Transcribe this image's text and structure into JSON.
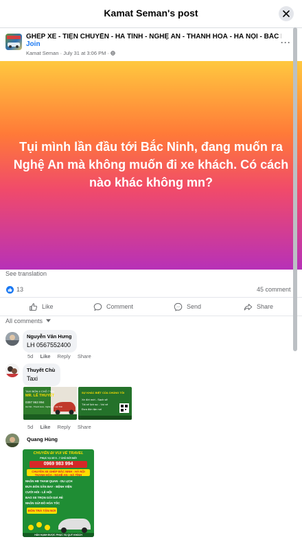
{
  "header": {
    "title": "Kamat Seman's post"
  },
  "post": {
    "group_name": "GHÉP XE - TIỆN CHUYẾN - HÀ TĨNH - NGHỆ AN - THANH HOÁ - HÀ NỘI - BẮC NINH -",
    "join_label": "Join",
    "author": "Kamat Seman",
    "separator": "·",
    "date": "July 31 at 3:06 PM",
    "text": "Tụi mình lần đầu tới Bắc Ninh, đang muốn ra Nghệ An mà không muốn đi xe khách. Có cách nào khác không mn?",
    "see_translation": "See translation",
    "like_count": "13",
    "comment_count": "45 comment"
  },
  "actions": {
    "like": "Like",
    "comment": "Comment",
    "send": "Send",
    "share": "Share"
  },
  "comments_filter": "All comments",
  "comments": [
    {
      "author": "Nguyễn Văn Hưng",
      "text": "LH 0567552400",
      "time": "5d",
      "like": "Like",
      "reply": "Reply",
      "share": "Share"
    },
    {
      "author": "Thuyết Chù",
      "text": "Taxi",
      "time": "5d",
      "like": "Like",
      "reply": "Reply",
      "share": "Share",
      "card1": {
        "line1": "TAXI BỐN 4 CHỖ 7 HN",
        "line2": "MR. LÊ THUYẾT",
        "line3": "0397 963 994",
        "line4": "Hà Nội - Thanh Hoá - Nghệ An - Hà Tĩnh"
      },
      "card2": {
        "line1": "SỰ KHÁC BIỆT CỦA CHÚNG TÔI",
        "line2": "Xe đời mới - Sạch sẽ",
        "line3": "Tài xế lịch sự - Vui vẻ",
        "line4": "Đưa đón tận nơi"
      }
    },
    {
      "author": "Quang Hùng",
      "flyer": {
        "title": "CHUYÊN ĐI VUI VẺ TRAVEL",
        "subtitle": "PHỤC VỤ XE 5 - 7 CHỖ ĐỜI MỚI",
        "phone": "0969 983 994",
        "route1": "CHUYÊN XE GHÉP BẮC NINH - HÀ NỘI",
        "route2": "THANH HÓA - NGHỆ AN - HÀ TĨNH",
        "services": [
          "NHẬN HĐ THAM QUAN - DU LỊCH",
          "ĐƯA ĐÓN SÂN BAY - BỆNH VIỆN",
          "CƯỚI HỎI - LỄ HỘI",
          "BAO XE TRỌN GÓI GIÁ RẺ",
          "NHẬN GỬI ĐỒ HỎA TỐC"
        ],
        "badge": "ĐÓN TRẢ TẬN NƠI",
        "footer": "HÂN HẠNH ĐƯỢC PHỤC VỤ QUÝ KHÁCH"
      }
    }
  ],
  "colors": {
    "accent": "#1877f2",
    "muted": "#65676b",
    "bubble": "#f0f2f5",
    "flyer_green": "#1f8d34",
    "flyer_red": "#d62828",
    "flyer_yellow": "#ffde00"
  }
}
